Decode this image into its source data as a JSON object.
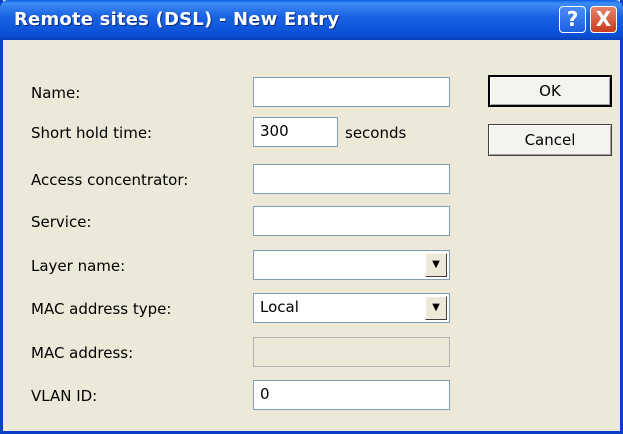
{
  "window": {
    "title": "Remote sites (DSL) - New Entry",
    "help_label": "?",
    "close_label": "X"
  },
  "form": {
    "name": {
      "label": "Name:",
      "value": ""
    },
    "short_hold_time": {
      "label": "Short hold time:",
      "value": "300",
      "unit": "seconds"
    },
    "access_concentrator": {
      "label": "Access concentrator:",
      "value": ""
    },
    "service": {
      "label": "Service:",
      "value": ""
    },
    "layer_name": {
      "label": "Layer name:",
      "value": ""
    },
    "mac_address_type": {
      "label": "MAC address type:",
      "value": "Local"
    },
    "mac_address": {
      "label": "MAC address:",
      "value": ""
    },
    "vlan_id": {
      "label": "VLAN ID:",
      "value": "0"
    }
  },
  "buttons": {
    "ok": "OK",
    "cancel": "Cancel"
  }
}
